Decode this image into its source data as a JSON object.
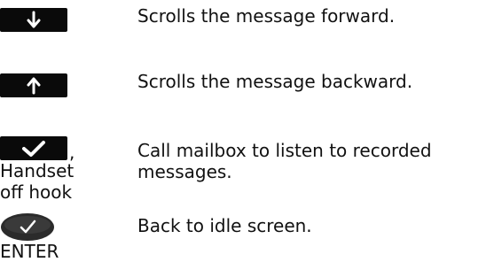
{
  "rows": [
    {
      "key_icon": "arrow-down-icon",
      "description": "Scrolls the message forward."
    },
    {
      "key_icon": "arrow-up-icon",
      "description": "Scrolls the message backward."
    },
    {
      "key_icon": "checkmark-icon",
      "key_suffix": ",",
      "key_note": "Handset\noff hook",
      "description": "Call mailbox to listen to recorded\nmessages."
    },
    {
      "key_icon": "enter-check-icon",
      "key_label": "ENTER",
      "description": "Back to idle screen."
    }
  ],
  "colors": {
    "key_background": "#0a0a0a",
    "key_symbol": "#ffffff",
    "enter_oval": "#2b2b2b"
  }
}
